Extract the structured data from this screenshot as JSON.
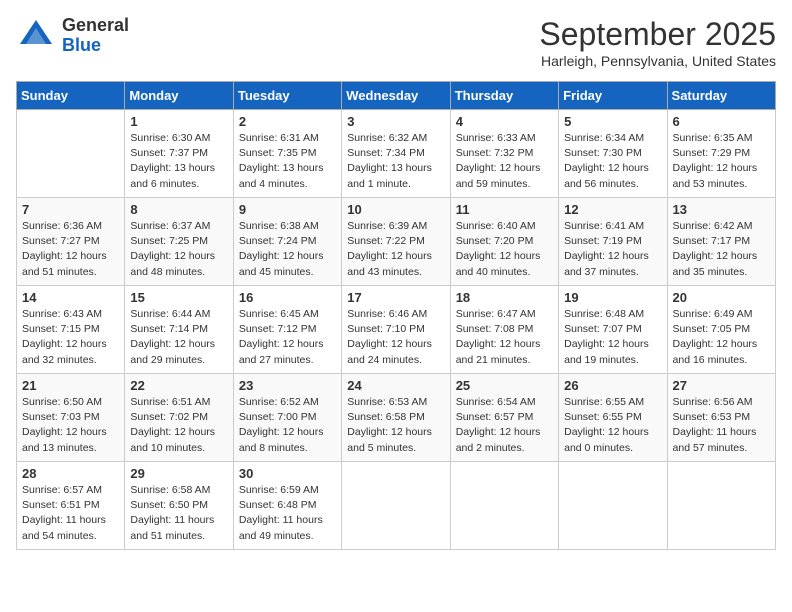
{
  "logo": {
    "line1": "General",
    "line2": "Blue"
  },
  "title": "September 2025",
  "location": "Harleigh, Pennsylvania, United States",
  "days_of_week": [
    "Sunday",
    "Monday",
    "Tuesday",
    "Wednesday",
    "Thursday",
    "Friday",
    "Saturday"
  ],
  "weeks": [
    [
      {
        "num": "",
        "info": ""
      },
      {
        "num": "1",
        "info": "Sunrise: 6:30 AM\nSunset: 7:37 PM\nDaylight: 13 hours\nand 6 minutes."
      },
      {
        "num": "2",
        "info": "Sunrise: 6:31 AM\nSunset: 7:35 PM\nDaylight: 13 hours\nand 4 minutes."
      },
      {
        "num": "3",
        "info": "Sunrise: 6:32 AM\nSunset: 7:34 PM\nDaylight: 13 hours\nand 1 minute."
      },
      {
        "num": "4",
        "info": "Sunrise: 6:33 AM\nSunset: 7:32 PM\nDaylight: 12 hours\nand 59 minutes."
      },
      {
        "num": "5",
        "info": "Sunrise: 6:34 AM\nSunset: 7:30 PM\nDaylight: 12 hours\nand 56 minutes."
      },
      {
        "num": "6",
        "info": "Sunrise: 6:35 AM\nSunset: 7:29 PM\nDaylight: 12 hours\nand 53 minutes."
      }
    ],
    [
      {
        "num": "7",
        "info": "Sunrise: 6:36 AM\nSunset: 7:27 PM\nDaylight: 12 hours\nand 51 minutes."
      },
      {
        "num": "8",
        "info": "Sunrise: 6:37 AM\nSunset: 7:25 PM\nDaylight: 12 hours\nand 48 minutes."
      },
      {
        "num": "9",
        "info": "Sunrise: 6:38 AM\nSunset: 7:24 PM\nDaylight: 12 hours\nand 45 minutes."
      },
      {
        "num": "10",
        "info": "Sunrise: 6:39 AM\nSunset: 7:22 PM\nDaylight: 12 hours\nand 43 minutes."
      },
      {
        "num": "11",
        "info": "Sunrise: 6:40 AM\nSunset: 7:20 PM\nDaylight: 12 hours\nand 40 minutes."
      },
      {
        "num": "12",
        "info": "Sunrise: 6:41 AM\nSunset: 7:19 PM\nDaylight: 12 hours\nand 37 minutes."
      },
      {
        "num": "13",
        "info": "Sunrise: 6:42 AM\nSunset: 7:17 PM\nDaylight: 12 hours\nand 35 minutes."
      }
    ],
    [
      {
        "num": "14",
        "info": "Sunrise: 6:43 AM\nSunset: 7:15 PM\nDaylight: 12 hours\nand 32 minutes."
      },
      {
        "num": "15",
        "info": "Sunrise: 6:44 AM\nSunset: 7:14 PM\nDaylight: 12 hours\nand 29 minutes."
      },
      {
        "num": "16",
        "info": "Sunrise: 6:45 AM\nSunset: 7:12 PM\nDaylight: 12 hours\nand 27 minutes."
      },
      {
        "num": "17",
        "info": "Sunrise: 6:46 AM\nSunset: 7:10 PM\nDaylight: 12 hours\nand 24 minutes."
      },
      {
        "num": "18",
        "info": "Sunrise: 6:47 AM\nSunset: 7:08 PM\nDaylight: 12 hours\nand 21 minutes."
      },
      {
        "num": "19",
        "info": "Sunrise: 6:48 AM\nSunset: 7:07 PM\nDaylight: 12 hours\nand 19 minutes."
      },
      {
        "num": "20",
        "info": "Sunrise: 6:49 AM\nSunset: 7:05 PM\nDaylight: 12 hours\nand 16 minutes."
      }
    ],
    [
      {
        "num": "21",
        "info": "Sunrise: 6:50 AM\nSunset: 7:03 PM\nDaylight: 12 hours\nand 13 minutes."
      },
      {
        "num": "22",
        "info": "Sunrise: 6:51 AM\nSunset: 7:02 PM\nDaylight: 12 hours\nand 10 minutes."
      },
      {
        "num": "23",
        "info": "Sunrise: 6:52 AM\nSunset: 7:00 PM\nDaylight: 12 hours\nand 8 minutes."
      },
      {
        "num": "24",
        "info": "Sunrise: 6:53 AM\nSunset: 6:58 PM\nDaylight: 12 hours\nand 5 minutes."
      },
      {
        "num": "25",
        "info": "Sunrise: 6:54 AM\nSunset: 6:57 PM\nDaylight: 12 hours\nand 2 minutes."
      },
      {
        "num": "26",
        "info": "Sunrise: 6:55 AM\nSunset: 6:55 PM\nDaylight: 12 hours\nand 0 minutes."
      },
      {
        "num": "27",
        "info": "Sunrise: 6:56 AM\nSunset: 6:53 PM\nDaylight: 11 hours\nand 57 minutes."
      }
    ],
    [
      {
        "num": "28",
        "info": "Sunrise: 6:57 AM\nSunset: 6:51 PM\nDaylight: 11 hours\nand 54 minutes."
      },
      {
        "num": "29",
        "info": "Sunrise: 6:58 AM\nSunset: 6:50 PM\nDaylight: 11 hours\nand 51 minutes."
      },
      {
        "num": "30",
        "info": "Sunrise: 6:59 AM\nSunset: 6:48 PM\nDaylight: 11 hours\nand 49 minutes."
      },
      {
        "num": "",
        "info": ""
      },
      {
        "num": "",
        "info": ""
      },
      {
        "num": "",
        "info": ""
      },
      {
        "num": "",
        "info": ""
      }
    ]
  ]
}
